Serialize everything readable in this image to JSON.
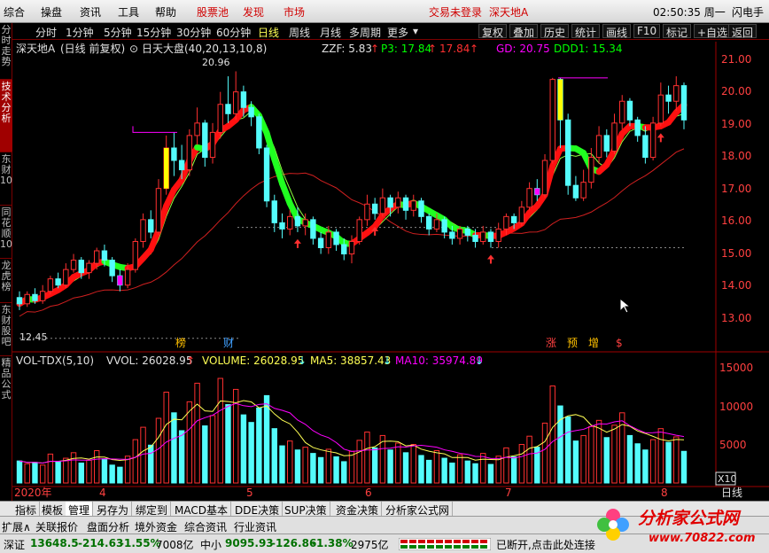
{
  "menu": {
    "items": [
      "综合",
      "操盘",
      "资讯",
      "工具",
      "帮助"
    ],
    "red_items": [
      "股票池",
      "发现",
      "市场"
    ],
    "login": "交易未登录",
    "stock": "深天地A",
    "time": "02:50:35 周一",
    "right": "闪电手"
  },
  "periods": [
    "分时",
    "1分钟",
    "5分钟",
    "15分钟",
    "30分钟",
    "60分钟",
    "日线",
    "周线",
    "月线",
    "多周期",
    "更多"
  ],
  "selected_period": "日线",
  "toolbar": [
    "复权",
    "叠加",
    "历史",
    "统计",
    "画线",
    "F10",
    "标记",
    "+自选",
    "返回"
  ],
  "side_tabs": [
    "分时走势",
    "技术分析",
    "东财10",
    "同花顺10",
    "龙虎榜",
    "东财股吧",
    "精品公式"
  ],
  "main_header": {
    "name": "深天地A",
    "mode": "(日线 前复权)",
    "index": "日天大盘(40,20,13,10,8)",
    "zzf": "ZZF: 5.83",
    "p3": "P3: 17.84",
    "p3b": "17.84",
    "gd": "GD: 20.75",
    "ddd1": "DDD1: 15.34"
  },
  "price_axis": [
    "21.00",
    "20.00",
    "19.00",
    "18.00",
    "17.00",
    "16.00",
    "15.00",
    "14.00",
    "13.00"
  ],
  "annot": {
    "high": "20.96",
    "low": "12.45",
    "bang": "榜",
    "cai": "财",
    "zhang": "涨",
    "yu": "预",
    "zeng": "增",
    "s": "$"
  },
  "vol_header": {
    "name": "VOL-TDX(5,10)",
    "vvol": "VVOL: 26028.95",
    "volume": "VOLUME: 26028.95",
    "ma5": "MA5: 38857.43",
    "ma10": "MA10: 35974.89"
  },
  "vol_axis": [
    "15000",
    "10000",
    "5000"
  ],
  "vol_unit": "X10",
  "date_axis": {
    "year": "2020年",
    "m4": "4",
    "m5": "5",
    "m6": "6",
    "m7": "7",
    "m8": "8",
    "period": "日线"
  },
  "bottom_tabs": [
    "指标",
    "模板",
    "管理",
    "另存为",
    "绑定到",
    "MACD基本",
    "DDE决策",
    "SUP决策",
    "资金决策",
    "分析家公式网"
  ],
  "bottom_sel": "管理",
  "status1": [
    "扩展∧",
    "关联报价",
    "盘面分析",
    "境外资金",
    "综合资讯",
    "行业资讯"
  ],
  "sz": {
    "label": "深证",
    "value": "13648.5",
    "chg": "-214.63",
    "pct": "-1.55%",
    "amt": "7008亿"
  },
  "zx": {
    "label": "中小",
    "value": "9095.93",
    "chg": "-126.86",
    "pct": "-1.38%",
    "amt": "2975亿"
  },
  "conn": "已断开,点击此处连接",
  "logo": "分析家公式网",
  "logo_url": "www.70822.com",
  "colors": {
    "up": "#ff3030",
    "down": "#54fcfc",
    "yellow": "#ffff00",
    "green": "#00ff00",
    "magenta": "#ff00ff"
  },
  "chart_data": {
    "type": "candlestick",
    "ylim": [
      12.3,
      21.4
    ],
    "candles": [
      [
        13.7,
        13.5,
        13.9,
        13.3
      ],
      [
        13.5,
        13.8,
        13.9,
        13.4
      ],
      [
        13.8,
        13.6,
        14.0,
        13.5
      ],
      [
        13.6,
        13.9,
        14.1,
        13.5
      ],
      [
        13.9,
        14.3,
        14.4,
        13.8
      ],
      [
        14.3,
        14.1,
        14.5,
        14.0
      ],
      [
        14.1,
        14.6,
        14.8,
        14.0
      ],
      [
        14.6,
        14.9,
        15.1,
        14.5
      ],
      [
        14.9,
        14.5,
        15.0,
        14.3
      ],
      [
        14.5,
        14.8,
        14.9,
        14.3
      ],
      [
        14.8,
        15.2,
        15.3,
        14.6
      ],
      [
        15.2,
        14.9,
        15.4,
        14.7
      ],
      [
        14.9,
        14.4,
        15.0,
        14.2
      ],
      [
        14.4,
        14.1,
        14.6,
        13.9
      ],
      [
        14.1,
        14.6,
        14.8,
        14.0
      ],
      [
        14.6,
        15.5,
        15.6,
        14.5
      ],
      [
        15.5,
        16.2,
        16.4,
        15.3
      ],
      [
        16.2,
        15.8,
        16.5,
        15.6
      ],
      [
        15.8,
        17.2,
        17.5,
        15.7
      ],
      [
        17.2,
        18.5,
        18.9,
        17.0
      ],
      [
        18.5,
        18.1,
        19.0,
        17.6
      ],
      [
        18.1,
        17.8,
        18.6,
        17.5
      ],
      [
        17.8,
        18.9,
        19.1,
        17.6
      ],
      [
        18.9,
        19.3,
        19.8,
        18.6
      ],
      [
        19.3,
        18.2,
        19.4,
        17.9
      ],
      [
        18.2,
        19.0,
        19.3,
        18.0
      ],
      [
        19.0,
        19.9,
        20.3,
        18.8
      ],
      [
        19.9,
        19.6,
        20.8,
        19.3
      ],
      [
        19.6,
        20.3,
        20.96,
        19.4
      ],
      [
        20.3,
        19.8,
        20.5,
        19.5
      ],
      [
        19.8,
        19.5,
        20.0,
        19.2
      ],
      [
        19.5,
        18.5,
        19.6,
        18.3
      ],
      [
        18.5,
        16.8,
        18.6,
        16.6
      ],
      [
        16.8,
        16.1,
        17.0,
        15.8
      ],
      [
        16.1,
        15.9,
        16.4,
        15.6
      ],
      [
        15.9,
        16.3,
        16.5,
        15.7
      ],
      [
        16.3,
        16.0,
        16.6,
        15.8
      ],
      [
        16.0,
        16.2,
        16.4,
        15.7
      ],
      [
        16.2,
        15.6,
        16.3,
        15.4
      ],
      [
        15.6,
        15.3,
        15.8,
        15.1
      ],
      [
        15.3,
        15.8,
        16.0,
        15.1
      ],
      [
        15.8,
        15.4,
        15.9,
        15.2
      ],
      [
        15.4,
        15.1,
        15.6,
        14.9
      ],
      [
        15.1,
        15.5,
        15.7,
        14.8
      ],
      [
        15.5,
        16.2,
        16.3,
        15.4
      ],
      [
        16.2,
        16.7,
        17.0,
        16.0
      ],
      [
        16.7,
        16.4,
        16.9,
        16.2
      ],
      [
        16.4,
        16.9,
        17.2,
        16.3
      ],
      [
        16.9,
        16.6,
        17.0,
        16.3
      ],
      [
        16.6,
        16.9,
        17.1,
        16.4
      ],
      [
        16.9,
        16.5,
        17.0,
        16.2
      ],
      [
        16.5,
        16.8,
        17.0,
        16.3
      ],
      [
        16.8,
        16.3,
        16.9,
        16.1
      ],
      [
        16.3,
        15.9,
        16.4,
        15.7
      ],
      [
        15.9,
        16.2,
        16.4,
        15.8
      ],
      [
        16.2,
        15.8,
        16.3,
        15.6
      ],
      [
        15.8,
        15.6,
        16.0,
        15.4
      ],
      [
        15.6,
        15.9,
        16.0,
        15.4
      ],
      [
        15.9,
        15.7,
        16.0,
        15.5
      ],
      [
        15.7,
        15.5,
        15.9,
        15.3
      ],
      [
        15.5,
        15.8,
        16.0,
        15.4
      ],
      [
        15.8,
        15.5,
        15.9,
        15.3
      ],
      [
        15.5,
        15.9,
        16.1,
        15.3
      ],
      [
        15.9,
        16.3,
        16.4,
        15.7
      ],
      [
        16.3,
        16.1,
        16.4,
        15.9
      ],
      [
        16.1,
        16.6,
        16.8,
        16.0
      ],
      [
        16.6,
        17.2,
        17.4,
        16.5
      ],
      [
        17.2,
        17.0,
        17.5,
        16.8
      ],
      [
        17.0,
        18.1,
        18.3,
        16.9
      ],
      [
        18.1,
        20.7,
        20.75,
        18.0
      ],
      [
        20.7,
        19.4,
        20.75,
        18.5
      ],
      [
        19.4,
        17.3,
        19.6,
        17.0
      ],
      [
        17.3,
        16.9,
        17.6,
        16.8
      ],
      [
        16.9,
        17.4,
        17.8,
        16.8
      ],
      [
        17.4,
        18.2,
        18.5,
        17.2
      ],
      [
        18.2,
        18.9,
        19.2,
        18.0
      ],
      [
        18.9,
        18.4,
        19.1,
        18.2
      ],
      [
        18.4,
        19.3,
        19.6,
        18.3
      ],
      [
        19.3,
        20.0,
        20.2,
        19.1
      ],
      [
        20.0,
        19.4,
        20.1,
        19.2
      ],
      [
        19.4,
        18.9,
        19.5,
        18.7
      ],
      [
        18.9,
        18.2,
        19.2,
        18.0
      ],
      [
        18.2,
        19.3,
        19.5,
        18.1
      ],
      [
        19.3,
        20.2,
        20.6,
        19.2
      ],
      [
        20.2,
        20.0,
        20.5,
        19.6
      ],
      [
        20.0,
        20.5,
        20.8,
        19.7
      ],
      [
        20.5,
        19.4,
        20.6,
        19.1
      ]
    ],
    "volumes": [
      3200,
      2800,
      3000,
      2600,
      4200,
      3100,
      3600,
      4400,
      2900,
      3300,
      4700,
      3500,
      2600,
      2300,
      3900,
      6300,
      8100,
      5500,
      9400,
      13200,
      10200,
      7600,
      11800,
      14500,
      8300,
      9800,
      15200,
      11400,
      13600,
      9900,
      8800,
      10900,
      12700,
      7900,
      5400,
      6100,
      4800,
      5200,
      4300,
      3700,
      4900,
      3800,
      3100,
      4600,
      6200,
      7400,
      5100,
      6900,
      4800,
      5800,
      4400,
      5600,
      4000,
      3300,
      4700,
      3600,
      2900,
      4100,
      3200,
      2800,
      4300,
      2700,
      3900,
      5100,
      3800,
      5600,
      6800,
      5200,
      8700,
      14100,
      11200,
      9600,
      6100,
      6900,
      8200,
      9100,
      6600,
      8400,
      10200,
      6900,
      5700,
      4800,
      6300,
      7900,
      5900,
      6700,
      4600
    ],
    "ma5_last": 38857.43,
    "ma10_last": 35974.89,
    "vol_ylim": [
      0,
      17000
    ]
  }
}
